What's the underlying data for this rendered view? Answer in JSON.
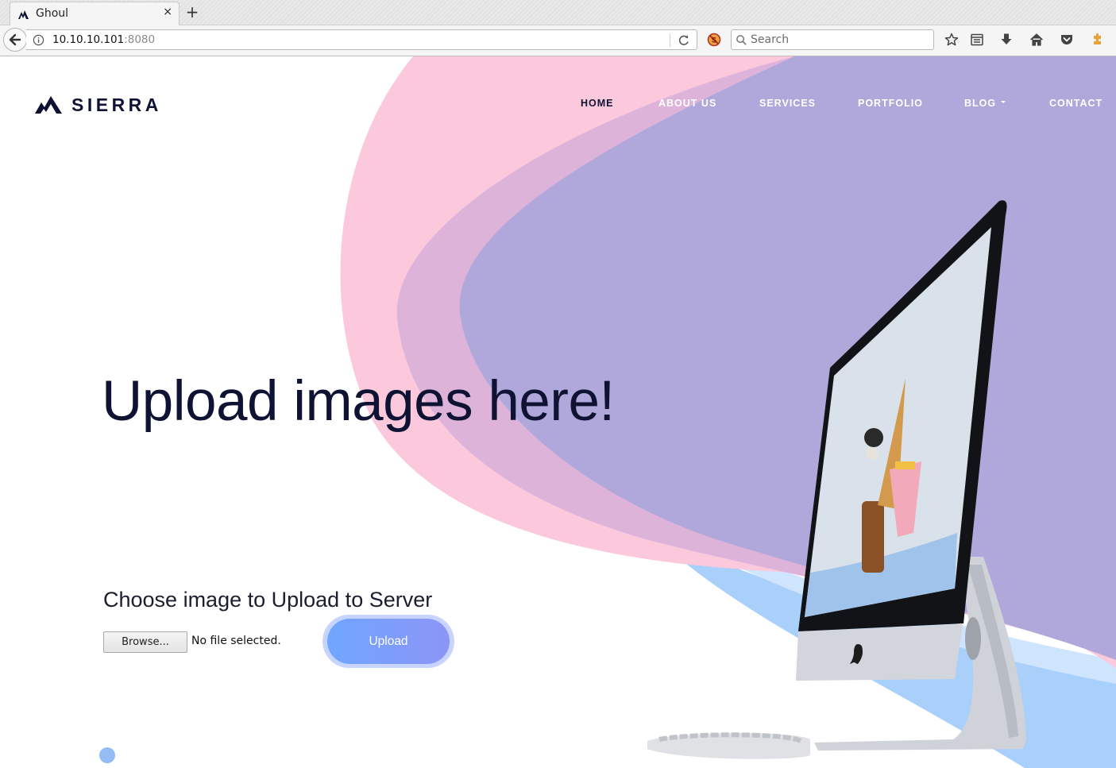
{
  "browser": {
    "tab_title": "Ghoul",
    "tab_close_glyph": "×",
    "new_tab_glyph": "+",
    "url_host": "10.10.10.101",
    "url_port": ":8080",
    "search_placeholder": "Search",
    "icons": [
      "back-arrow-icon",
      "site-info-icon",
      "reload-icon",
      "noscript-icon",
      "search-icon",
      "bookmark-star-icon",
      "reading-list-icon",
      "download-icon",
      "home-icon",
      "pocket-icon",
      "extension-icon"
    ]
  },
  "site": {
    "brand": "SIERRA",
    "nav": [
      {
        "label": "HOME",
        "active": true
      },
      {
        "label": "ABOUT US"
      },
      {
        "label": "SERVICES"
      },
      {
        "label": "PORTFOLIO"
      },
      {
        "label": "BLOG",
        "has_dropdown": true
      },
      {
        "label": "CONTACT"
      }
    ]
  },
  "hero": {
    "title": "Upload images here!"
  },
  "upload": {
    "heading": "Choose image to Upload to Server",
    "browse_label": "Browse...",
    "file_status": "No file selected.",
    "submit_label": "Upload"
  },
  "colors": {
    "brand_navy": "#0e1233",
    "pink_wave": "#fcc8dc",
    "mauve_wave": "#deb3da",
    "lavender": "#b0a8da",
    "light_blue": "#a8d0fb",
    "button_start": "#6fa6ff",
    "button_end": "#8c95f6"
  }
}
